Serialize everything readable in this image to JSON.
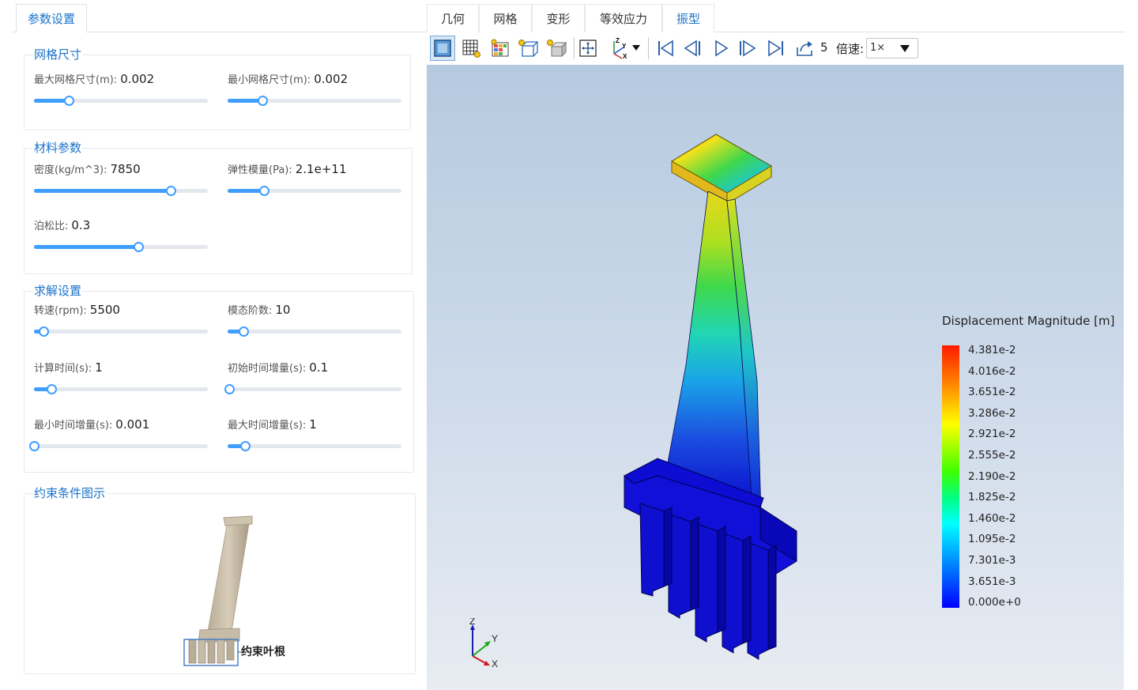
{
  "left_panel": {
    "tab_label": "参数设置",
    "mesh_group": {
      "title": "网格尺寸",
      "max_mesh": {
        "label": "最大网格尺寸(m):",
        "value": "0.002",
        "slider_fraction": 0.2
      },
      "min_mesh": {
        "label": "最小网格尺寸(m):",
        "value": "0.002",
        "slider_fraction": 0.2
      }
    },
    "material_group": {
      "title": "材料参数",
      "density": {
        "label": "密度(kg/m^3):",
        "value": "7850",
        "slider_fraction": 0.785
      },
      "modulus": {
        "label": "弹性模量(Pa):",
        "value": "2.1e+11",
        "slider_fraction": 0.21
      },
      "poisson": {
        "label": "泊松比:",
        "value": "0.3",
        "slider_fraction": 0.6
      }
    },
    "solver_group": {
      "title": "求解设置",
      "rpm": {
        "label": "转速(rpm):",
        "value": "5500",
        "slider_fraction": 0.055
      },
      "modes": {
        "label": "模态阶数:",
        "value": "10",
        "slider_fraction": 0.09
      },
      "calc_time": {
        "label": "计算时间(s):",
        "value": "1",
        "slider_fraction": 0.1
      },
      "init_step": {
        "label": "初始时间增量(s):",
        "value": "0.1",
        "slider_fraction": 0.01
      },
      "min_step": {
        "label": "最小时间增量(s):",
        "value": "0.001",
        "slider_fraction": 0.0
      },
      "max_step": {
        "label": "最大时间增量(s):",
        "value": "1",
        "slider_fraction": 0.1
      }
    },
    "constraint_group": {
      "title": "约束条件图示",
      "annotation": "约束叶根"
    }
  },
  "view_tabs": [
    {
      "label": "几何",
      "active": false
    },
    {
      "label": "网格",
      "active": false
    },
    {
      "label": "变形",
      "active": false
    },
    {
      "label": "等效应力",
      "active": false
    },
    {
      "label": "振型",
      "active": true
    }
  ],
  "toolbar": {
    "frame_number": "5",
    "speed_label": "倍速:",
    "speed_value": "1×"
  },
  "legend": {
    "title": "Displacement Magnitude [m]",
    "labels": [
      "4.381e-2",
      "4.016e-2",
      "3.651e-2",
      "3.286e-2",
      "2.921e-2",
      "2.555e-2",
      "2.190e-2",
      "1.825e-2",
      "1.460e-2",
      "1.095e-2",
      "7.301e-3",
      "3.651e-3",
      "0.000e+0"
    ]
  },
  "axes": {
    "x": "X",
    "y": "Y",
    "z": "Z"
  },
  "colors": {
    "accent": "#1a73c8",
    "slider": "#409eff",
    "root_blue": "#0a0acd"
  }
}
